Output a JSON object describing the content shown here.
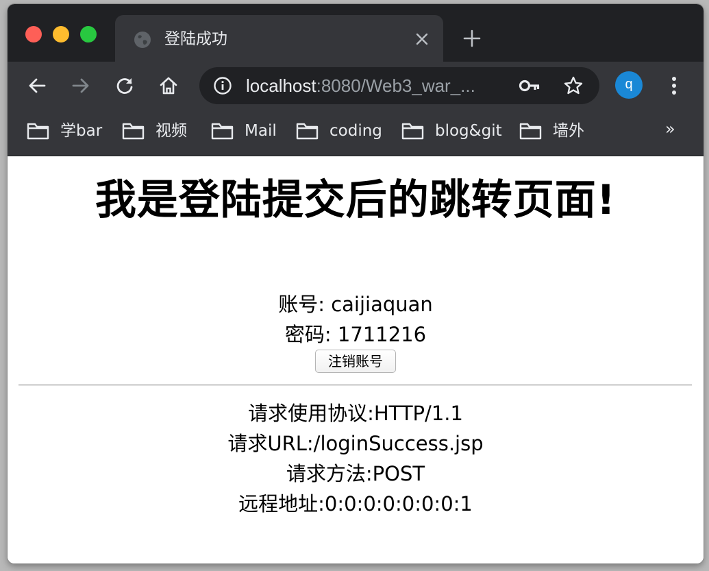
{
  "tab": {
    "title": "登陆成功"
  },
  "address_bar": {
    "host": "localhost",
    "rest": ":8080/Web3_war_..."
  },
  "profile": {
    "initial": "q",
    "color": "#1a88d6"
  },
  "bookmarks": [
    {
      "label": "学bar"
    },
    {
      "label": "视频"
    },
    {
      "label": "Mail"
    },
    {
      "label": "coding"
    },
    {
      "label": "blog&git"
    },
    {
      "label": "墙外"
    }
  ],
  "bookmarks_more": "»",
  "page": {
    "title": "我是登陆提交后的跳转页面!",
    "account_line": "账号: caijiaquan",
    "password_line": "密码: 1711216",
    "logout_button": "注销账号",
    "protocol_line": "请求使用协议:HTTP/1.1",
    "url_line": "请求URL:/loginSuccess.jsp",
    "method_line": "请求方法:POST",
    "remote_line": "远程地址:0:0:0:0:0:0:0:1"
  },
  "colors": {
    "tab_strip": "#202124",
    "toolbar": "#35363a",
    "accent_avatar": "#1a88d6"
  }
}
